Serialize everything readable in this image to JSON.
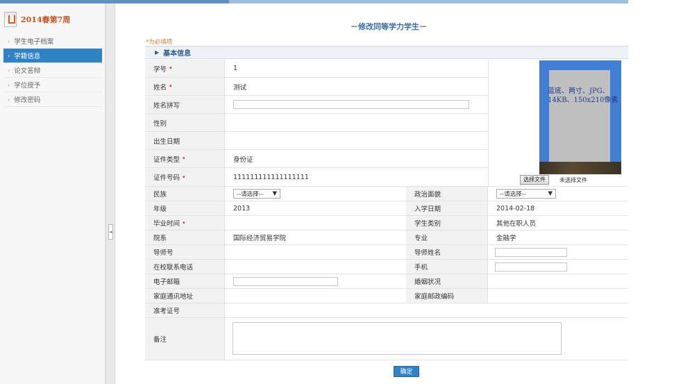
{
  "sidebar": {
    "title": "2014春第7周",
    "items": [
      {
        "label": "学生电子档案",
        "active": false
      },
      {
        "label": "学籍信息",
        "active": true
      },
      {
        "label": "论文答辩",
        "active": false
      },
      {
        "label": "学位授予",
        "active": false
      },
      {
        "label": "修改密码",
        "active": false
      }
    ]
  },
  "page": {
    "title": "－修改同等学力学生－",
    "required_note": "*为必填项",
    "section_title": "基本信息",
    "submit_label": "确定"
  },
  "form": {
    "xuehao_label": "学号",
    "xuehao_value": "1",
    "xingming_label": "姓名",
    "xingming_value": "测试",
    "pinyin_label": "姓名拼写",
    "xingbie_label": "性别",
    "chusheng_label": "出生日期",
    "zjlx_label": "证件类型",
    "zjlx_value": "身份证",
    "zjhm_label": "证件号码",
    "zjhm_value": "111111111111111111",
    "minzu_label": "民族",
    "minzu_value": "--请选择--",
    "zzmm_label": "政治面貌",
    "zzmm_value": "--请选择--",
    "nianji_label": "年级",
    "nianji_value": "2013",
    "rxrq_label": "入学日期",
    "rxrq_value": "2014-02-18",
    "bysj_label": "毕业时间",
    "xslb_label": "学生类别",
    "xslb_value": "其他在职人员",
    "yuanxi_label": "院系",
    "yuanxi_value": "国际经济贸易学院",
    "zhuanye_label": "专业",
    "zhuanye_value": "金融学",
    "dsh_label": "导师号",
    "dsxm_label": "导师姓名",
    "zxdh_label": "在校联系电话",
    "shouji_label": "手机",
    "email_label": "电子邮箱",
    "hyzk_label": "婚姻状况",
    "jtdz_label": "家庭通讯地址",
    "jtyb_label": "家庭邮政编码",
    "kszh_label": "准考证号",
    "beizhu_label": "备注"
  },
  "photo": {
    "note": "蓝底、两寸、JPG、14KB、150x210像素",
    "choose_button": "选择文件",
    "file_status": "未选择文件"
  },
  "colors": {
    "accent": "#2f83c4",
    "title": "#3a6fa5",
    "required": "#dd3333"
  }
}
